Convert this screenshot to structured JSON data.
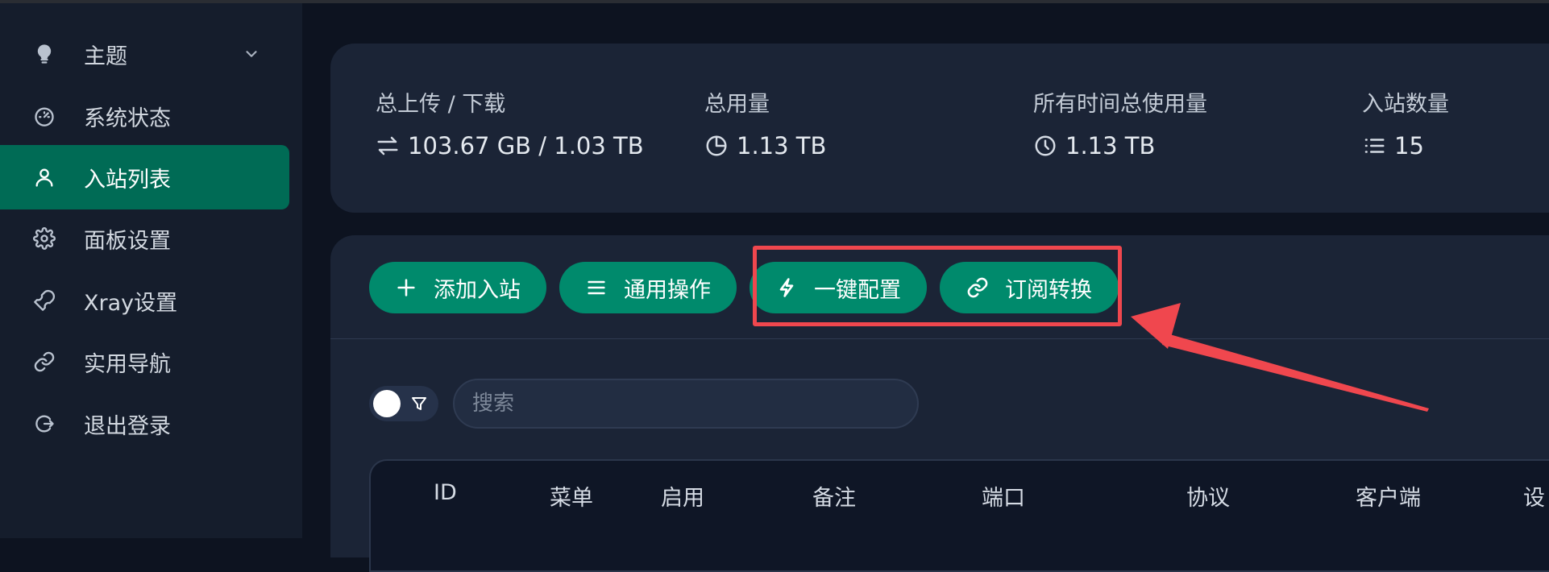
{
  "sidebar": {
    "items": [
      {
        "label": "主题",
        "icon": "lightbulb-icon",
        "expandable": true
      },
      {
        "label": "系统状态",
        "icon": "dashboard-icon"
      },
      {
        "label": "入站列表",
        "icon": "user-icon",
        "active": true
      },
      {
        "label": "面板设置",
        "icon": "gear-icon"
      },
      {
        "label": "Xray设置",
        "icon": "wrench-icon"
      },
      {
        "label": "实用导航",
        "icon": "link-icon"
      },
      {
        "label": "退出登录",
        "icon": "logout-icon"
      }
    ]
  },
  "stats": {
    "upload_download": {
      "label": "总上传 / 下载",
      "value": "103.67 GB / 1.03 TB",
      "icon": "swap-icon"
    },
    "total_usage": {
      "label": "总用量",
      "value": "1.13 TB",
      "icon": "pie-chart-icon"
    },
    "all_time_usage": {
      "label": "所有时间总使用量",
      "value": "1.13 TB",
      "icon": "clock-icon"
    },
    "inbound_count": {
      "label": "入站数量",
      "value": "15",
      "icon": "list-icon"
    }
  },
  "toolbar": {
    "add_inbound": "添加入站",
    "general_actions": "通用操作",
    "one_click_config": "一键配置",
    "subscription_convert": "订阅转换"
  },
  "search": {
    "placeholder": "搜索"
  },
  "table": {
    "columns": [
      "ID",
      "菜单",
      "启用",
      "备注",
      "端口",
      "协议",
      "客户端",
      "设"
    ]
  },
  "colors": {
    "accent": "#008a6c",
    "active_nav": "#006b55",
    "background": "#0d1320",
    "card": "#1b2436",
    "annotation": "#f0474e"
  }
}
